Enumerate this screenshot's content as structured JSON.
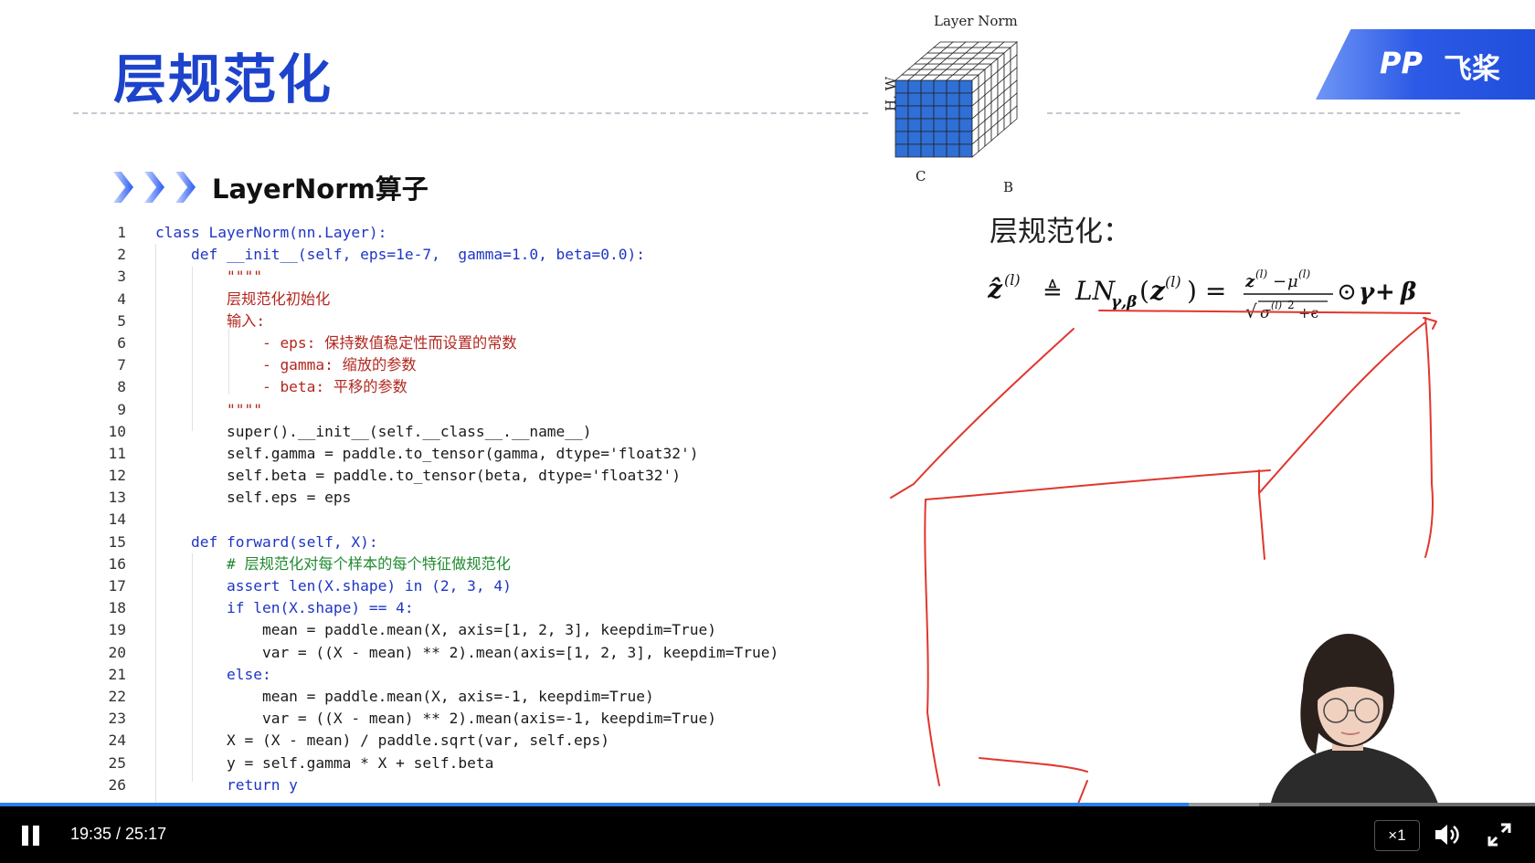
{
  "slide": {
    "title": "层规范化",
    "brand_logo": "PP",
    "brand_text": "飞桨",
    "section_title": "LayerNorm算子",
    "cube": {
      "title": "Layer Norm",
      "label_hw": "H, W",
      "label_c": "C",
      "label_b": "B"
    },
    "layernorm_heading": "层规范化：",
    "formula": {
      "lhs": "ẑ(l) ≜ LNγ,β(z(l)) =",
      "numerator": "z(l) − μ(l)",
      "denominator": "√σ(l)2+ϵ",
      "tail": "⊙γ+ β"
    },
    "code_lines": [
      {
        "n": "1",
        "t": "class LayerNorm(nn.Layer):"
      },
      {
        "n": "2",
        "t": "    def __init__(self, eps=1e-7,  gamma=1.0, beta=0.0):"
      },
      {
        "n": "3",
        "t": "        \"\"\"\""
      },
      {
        "n": "4",
        "t": "        层规范化初始化"
      },
      {
        "n": "5",
        "t": "        输入:"
      },
      {
        "n": "6",
        "t": "            - eps: 保持数值稳定性而设置的常数"
      },
      {
        "n": "7",
        "t": "            - gamma: 缩放的参数"
      },
      {
        "n": "8",
        "t": "            - beta: 平移的参数"
      },
      {
        "n": "9",
        "t": "        \"\"\"\""
      },
      {
        "n": "10",
        "t": "        super().__init__(self.__class__.__name__)"
      },
      {
        "n": "11",
        "t": "        self.gamma = paddle.to_tensor(gamma, dtype='float32')"
      },
      {
        "n": "12",
        "t": "        self.beta = paddle.to_tensor(beta, dtype='float32')"
      },
      {
        "n": "13",
        "t": "        self.eps = eps"
      },
      {
        "n": "14",
        "t": ""
      },
      {
        "n": "15",
        "t": "    def forward(self, X):"
      },
      {
        "n": "16",
        "t": "        # 层规范化对每个样本的每个特征做规范化"
      },
      {
        "n": "17",
        "t": "        assert len(X.shape) in (2, 3, 4)"
      },
      {
        "n": "18",
        "t": "        if len(X.shape) == 4:"
      },
      {
        "n": "19",
        "t": "            mean = paddle.mean(X, axis=[1, 2, 3], keepdim=True)"
      },
      {
        "n": "20",
        "t": "            var = ((X - mean) ** 2).mean(axis=[1, 2, 3], keepdim=True)"
      },
      {
        "n": "21",
        "t": "        else:"
      },
      {
        "n": "22",
        "t": "            mean = paddle.mean(X, axis=-1, keepdim=True)"
      },
      {
        "n": "23",
        "t": "            var = ((X - mean) ** 2).mean(axis=-1, keepdim=True)"
      },
      {
        "n": "24",
        "t": "        X = (X - mean) / paddle.sqrt(var, self.eps)"
      },
      {
        "n": "25",
        "t": "        y = self.gamma * X + self.beta"
      },
      {
        "n": "26",
        "t": "        return y"
      }
    ]
  },
  "player": {
    "current_time": "19:35",
    "duration": "25:17",
    "time_display": "19:35 / 25:17",
    "played_fraction": 0.7745,
    "buffered_fraction": 0.82,
    "speed_label": "×1",
    "pause_icon": "pause-icon",
    "volume_icon": "volume-icon",
    "fullscreen_icon": "fullscreen-icon"
  },
  "colors": {
    "title_blue": "#1d43cc",
    "cube_blue": "#2f6fd6",
    "ink_red": "#e0372f",
    "progress_blue": "#2a7ff0",
    "keyword_blue": "#1e35c4",
    "string_red": "#b3261e",
    "comment_green": "#1f8a2e"
  }
}
